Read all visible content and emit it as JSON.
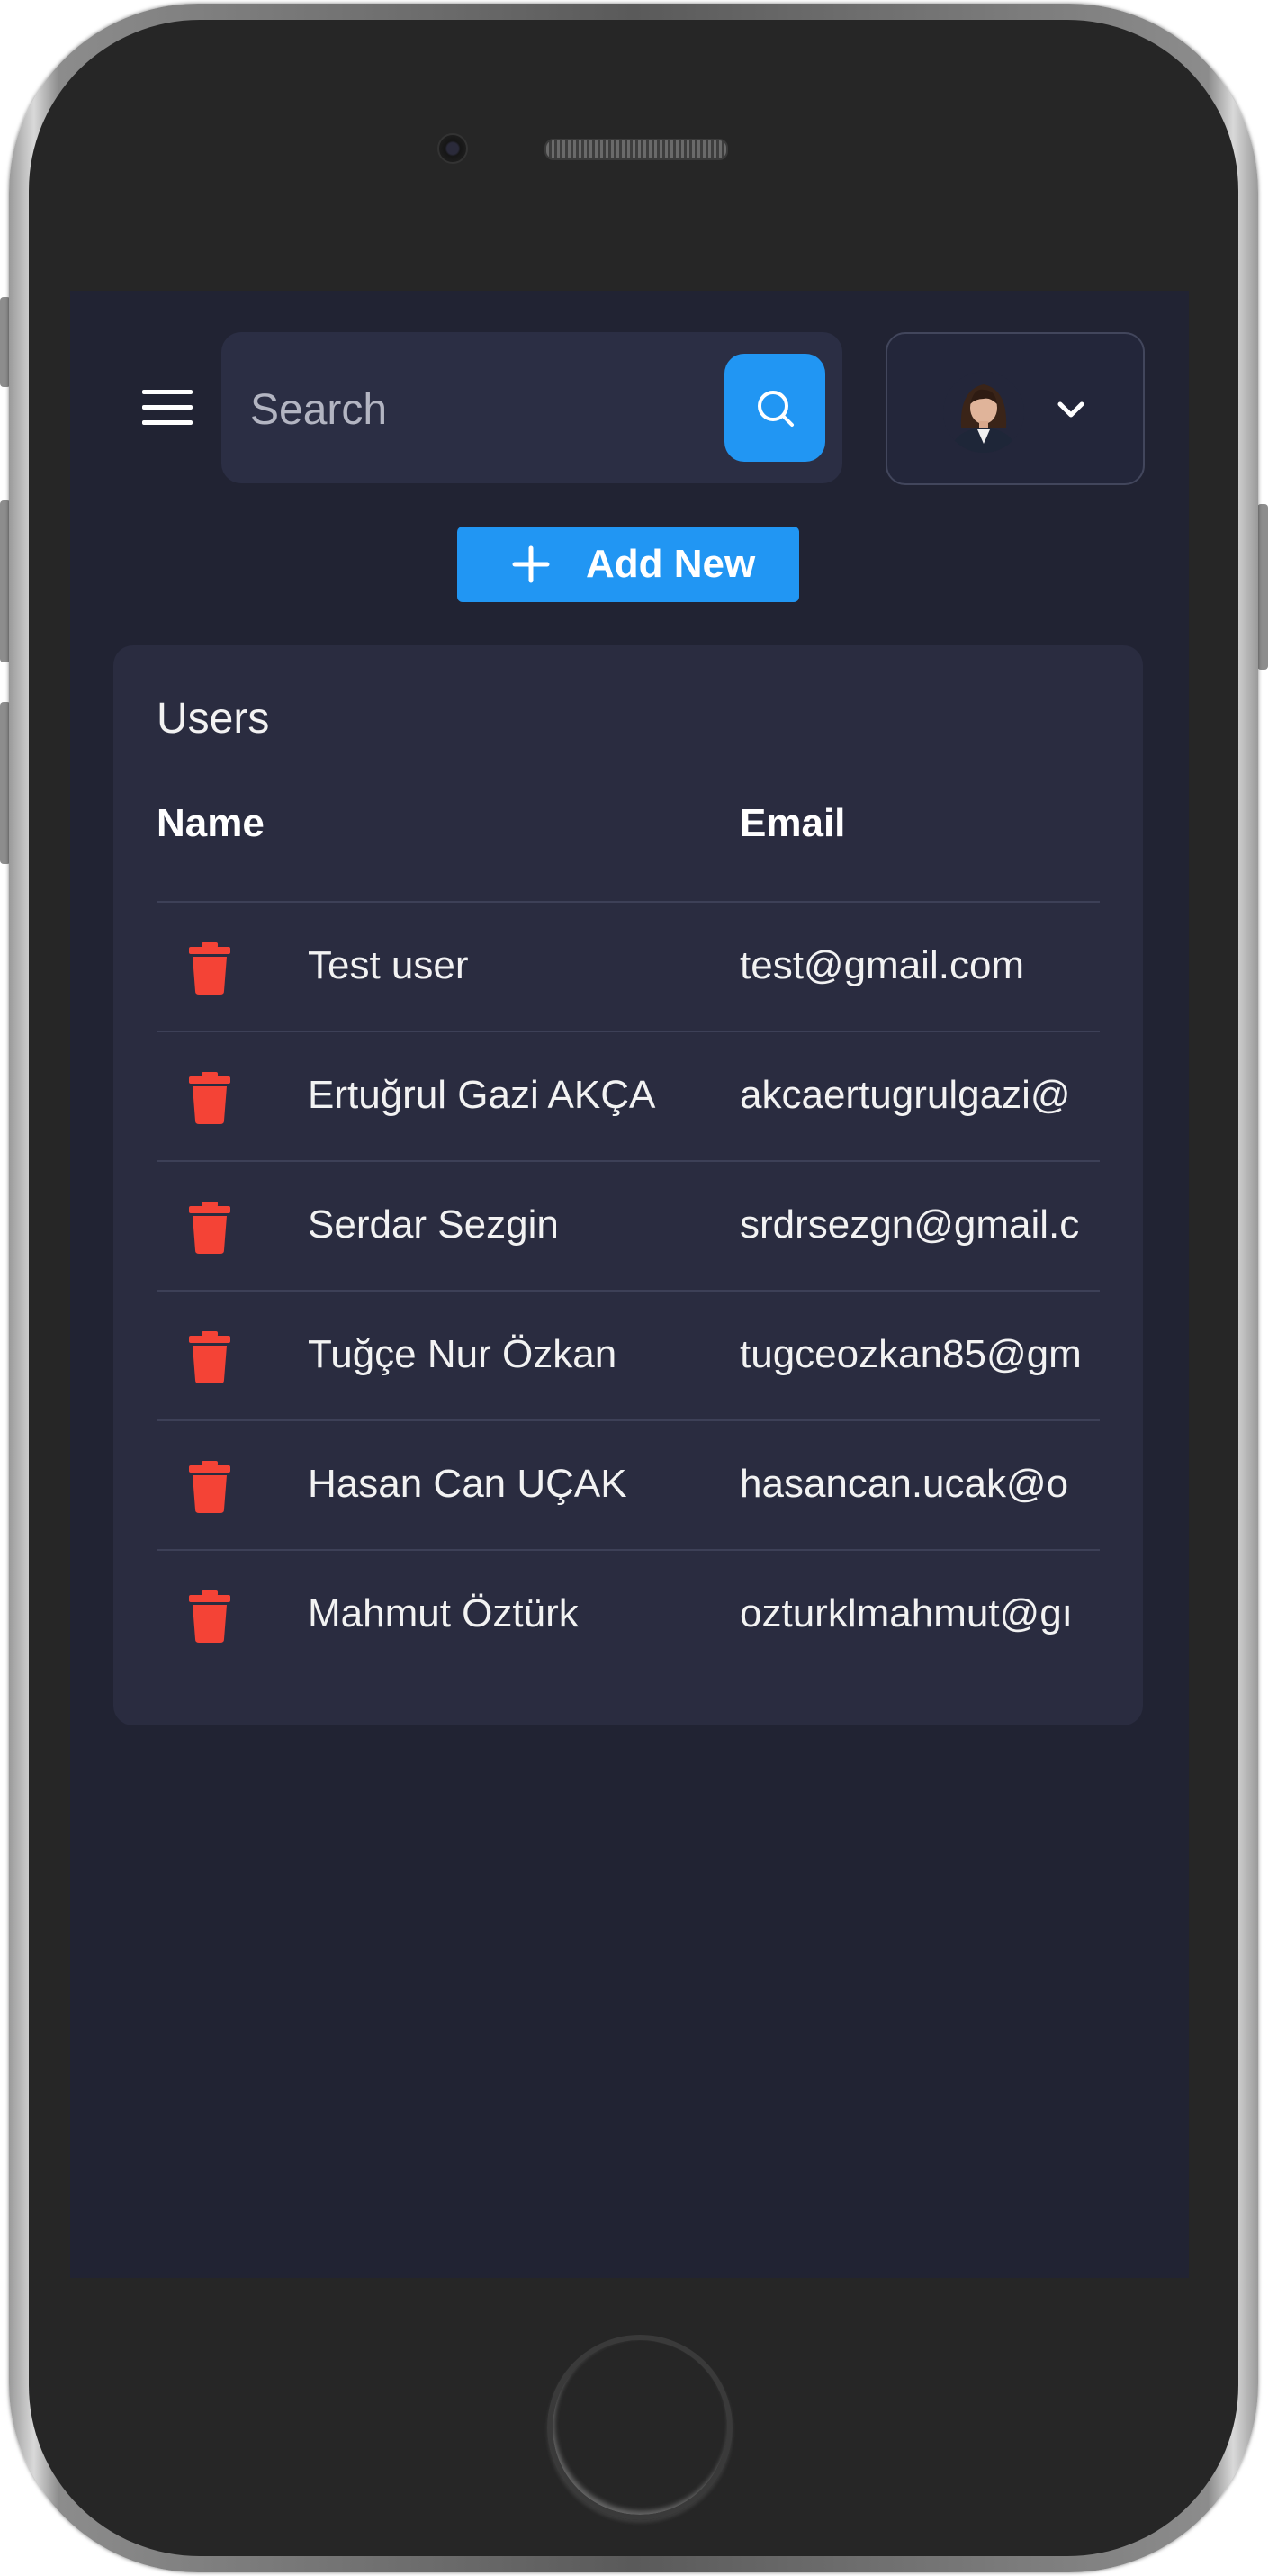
{
  "header": {
    "search": {
      "placeholder": "Search",
      "value": ""
    },
    "icons": {
      "menu": "hamburger-icon",
      "search": "search-icon",
      "profile_chevron": "chevron-down-icon"
    }
  },
  "toolbar": {
    "add_new_label": "Add New",
    "add_icon": "plus-icon"
  },
  "users_table": {
    "title": "Users",
    "columns": [
      "Name",
      "Email"
    ],
    "delete_icon": "trash-icon",
    "rows": [
      {
        "name": "Test user",
        "email": "test@gmail.com"
      },
      {
        "name": "Ertuğrul Gazi AKÇA",
        "email": "akcaertugrulgazi@"
      },
      {
        "name": "Serdar Sezgin",
        "email": "srdrsezgn@gmail.c"
      },
      {
        "name": "Tuğçe Nur Özkan",
        "email": "tugceozkan85@gm"
      },
      {
        "name": "Hasan Can UÇAK",
        "email": "hasancan.ucak@o"
      },
      {
        "name": "Mahmut Öztürk",
        "email": "ozturklmahmut@gı"
      }
    ]
  },
  "colors": {
    "screen_bg": "#212333",
    "card_bg": "#2a2c40",
    "accent": "#2196f3",
    "danger": "#f44336",
    "text": "#f2f2f2"
  }
}
